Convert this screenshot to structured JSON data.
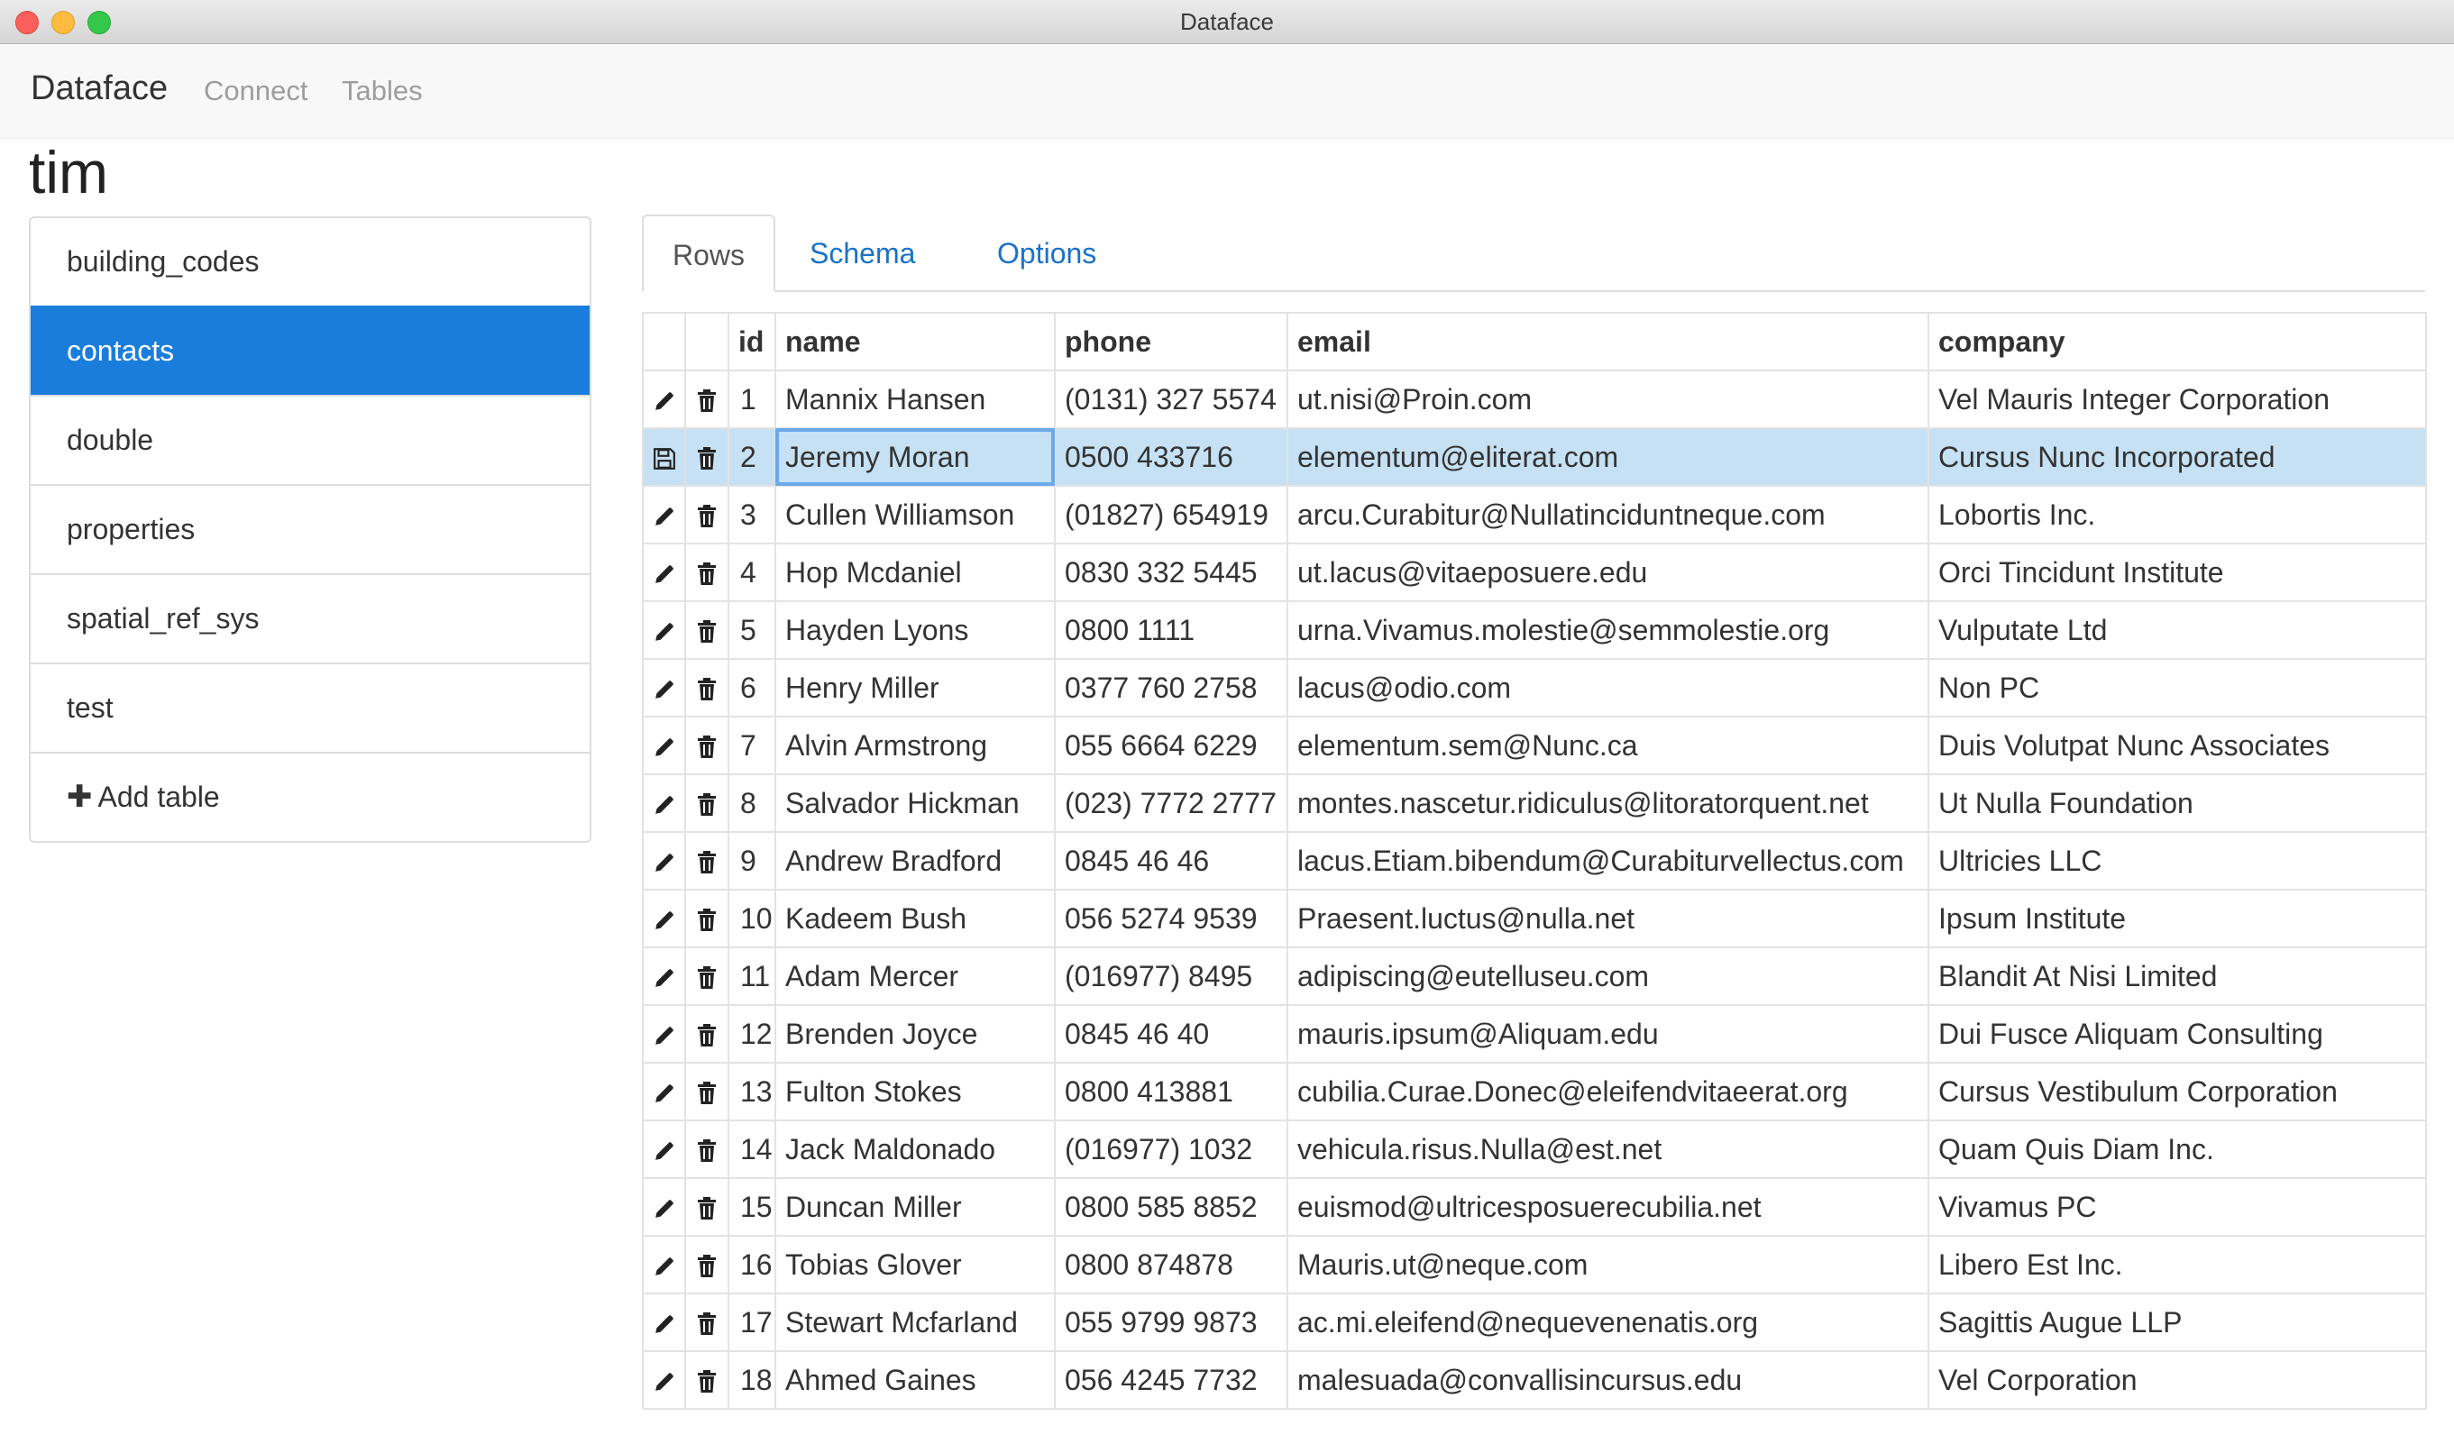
{
  "window": {
    "title": "Dataface"
  },
  "nav": {
    "brand": "Dataface",
    "links": [
      "Connect",
      "Tables"
    ]
  },
  "database": {
    "name": "tim"
  },
  "sidebar": {
    "items": [
      {
        "label": "building_codes",
        "active": false
      },
      {
        "label": "contacts",
        "active": true
      },
      {
        "label": "double",
        "active": false
      },
      {
        "label": "properties",
        "active": false
      },
      {
        "label": "spatial_ref_sys",
        "active": false
      },
      {
        "label": "test",
        "active": false
      }
    ],
    "add_label": "Add table"
  },
  "tabs": [
    {
      "label": "Rows",
      "active": true
    },
    {
      "label": "Schema",
      "active": false
    },
    {
      "label": "Options",
      "active": false
    }
  ],
  "table": {
    "columns": [
      "id",
      "name",
      "phone",
      "email",
      "company"
    ],
    "selected_row_id": "2",
    "rows": [
      {
        "id": "1",
        "name": "Mannix Hansen",
        "phone": "(0131) 327 5574",
        "email": "ut.nisi@Proin.com",
        "company": "Vel Mauris Integer Corporation"
      },
      {
        "id": "2",
        "name": "Jeremy Moran",
        "phone": "0500 433716",
        "email": "elementum@eliterat.com",
        "company": "Cursus Nunc Incorporated"
      },
      {
        "id": "3",
        "name": "Cullen Williamson",
        "phone": "(01827) 654919",
        "email": "arcu.Curabitur@Nullatinciduntneque.com",
        "company": "Lobortis Inc."
      },
      {
        "id": "4",
        "name": "Hop Mcdaniel",
        "phone": "0830 332 5445",
        "email": "ut.lacus@vitaeposuere.edu",
        "company": "Orci Tincidunt Institute"
      },
      {
        "id": "5",
        "name": "Hayden Lyons",
        "phone": "0800 1111",
        "email": "urna.Vivamus.molestie@semmolestie.org",
        "company": "Vulputate Ltd"
      },
      {
        "id": "6",
        "name": "Henry Miller",
        "phone": "0377 760 2758",
        "email": "lacus@odio.com",
        "company": "Non PC"
      },
      {
        "id": "7",
        "name": "Alvin Armstrong",
        "phone": "055 6664 6229",
        "email": "elementum.sem@Nunc.ca",
        "company": "Duis Volutpat Nunc Associates"
      },
      {
        "id": "8",
        "name": "Salvador Hickman",
        "phone": "(023) 7772 2777",
        "email": "montes.nascetur.ridiculus@litoratorquent.net",
        "company": "Ut Nulla Foundation"
      },
      {
        "id": "9",
        "name": "Andrew Bradford",
        "phone": "0845 46 46",
        "email": "lacus.Etiam.bibendum@Curabiturvellectus.com",
        "company": "Ultricies LLC"
      },
      {
        "id": "10",
        "name": "Kadeem Bush",
        "phone": "056 5274 9539",
        "email": "Praesent.luctus@nulla.net",
        "company": "Ipsum Institute"
      },
      {
        "id": "11",
        "name": "Adam Mercer",
        "phone": "(016977) 8495",
        "email": "adipiscing@eutelluseu.com",
        "company": "Blandit At Nisi Limited"
      },
      {
        "id": "12",
        "name": "Brenden Joyce",
        "phone": "0845 46 40",
        "email": "mauris.ipsum@Aliquam.edu",
        "company": "Dui Fusce Aliquam Consulting"
      },
      {
        "id": "13",
        "name": "Fulton Stokes",
        "phone": "0800 413881",
        "email": "cubilia.Curae.Donec@eleifendvitaeerat.org",
        "company": "Cursus Vestibulum Corporation"
      },
      {
        "id": "14",
        "name": "Jack Maldonado",
        "phone": "(016977) 1032",
        "email": "vehicula.risus.Nulla@est.net",
        "company": "Quam Quis Diam Inc."
      },
      {
        "id": "15",
        "name": "Duncan Miller",
        "phone": "0800 585 8852",
        "email": "euismod@ultricesposuerecubilia.net",
        "company": "Vivamus PC"
      },
      {
        "id": "16",
        "name": "Tobias Glover",
        "phone": "0800 874878",
        "email": "Mauris.ut@neque.com",
        "company": "Libero Est Inc."
      },
      {
        "id": "17",
        "name": "Stewart Mcfarland",
        "phone": "055 9799 9873",
        "email": "ac.mi.eleifend@nequevenenatis.org",
        "company": "Sagittis Augue LLP"
      },
      {
        "id": "18",
        "name": "Ahmed Gaines",
        "phone": "056 4245 7732",
        "email": "malesuada@convallisincursus.edu",
        "company": "Vel Corporation"
      }
    ]
  },
  "icons": {
    "edit": "pencil-icon",
    "delete": "trash-icon",
    "save": "save-icon",
    "add": "plus-icon"
  },
  "colors": {
    "accent": "#1a7ddc",
    "link": "#1a72c7",
    "selected_row": "#c6e1f3",
    "editing_outline": "#6aa9e9"
  }
}
